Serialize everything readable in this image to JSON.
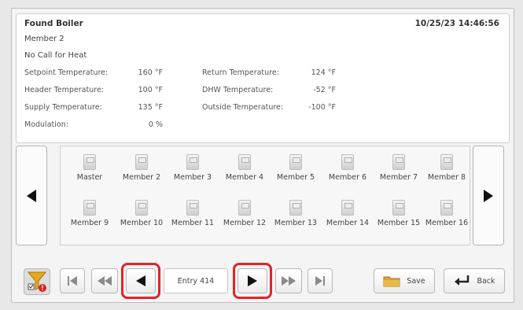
{
  "info": {
    "title": "Found Boiler",
    "timestamp": "10/25/23 14:46:56",
    "member": "Member 2",
    "status": "No Call for Heat",
    "left_rows": [
      {
        "label": "Setpoint Temperature:",
        "value": "160 °F"
      },
      {
        "label": "Header Temperature:",
        "value": "100 °F"
      },
      {
        "label": "Supply Temperature:",
        "value": "135 °F"
      },
      {
        "label": "Modulation:",
        "value": "0 %"
      }
    ],
    "right_rows": [
      {
        "label": "Return Temperature:",
        "value": "124 °F"
      },
      {
        "label": "DHW Temperature:",
        "value": "-52 °F"
      },
      {
        "label": "Outside Temperature:",
        "value": "-100 °F"
      }
    ]
  },
  "members": [
    "Master",
    "Member 2",
    "Member 3",
    "Member 4",
    "Member 5",
    "Member 6",
    "Member 7",
    "Member 8",
    "Member 9",
    "Member 10",
    "Member 11",
    "Member 12",
    "Member 13",
    "Member 14",
    "Member 15",
    "Member 16"
  ],
  "toolbar": {
    "entry_label": "Entry 414",
    "save_label": "Save",
    "back_label": "Back"
  },
  "icons": {
    "filter": "filter-icon",
    "first": "skip-to-first-icon",
    "rewind": "fast-rewind-icon",
    "prev": "previous-icon",
    "next": "next-icon",
    "forward": "fast-forward-icon",
    "last": "skip-to-last-icon",
    "save": "folder-icon",
    "back": "back-arrow-icon"
  },
  "colors": {
    "highlight": "#e0242b",
    "filter_funnel": "#e6a81e"
  }
}
